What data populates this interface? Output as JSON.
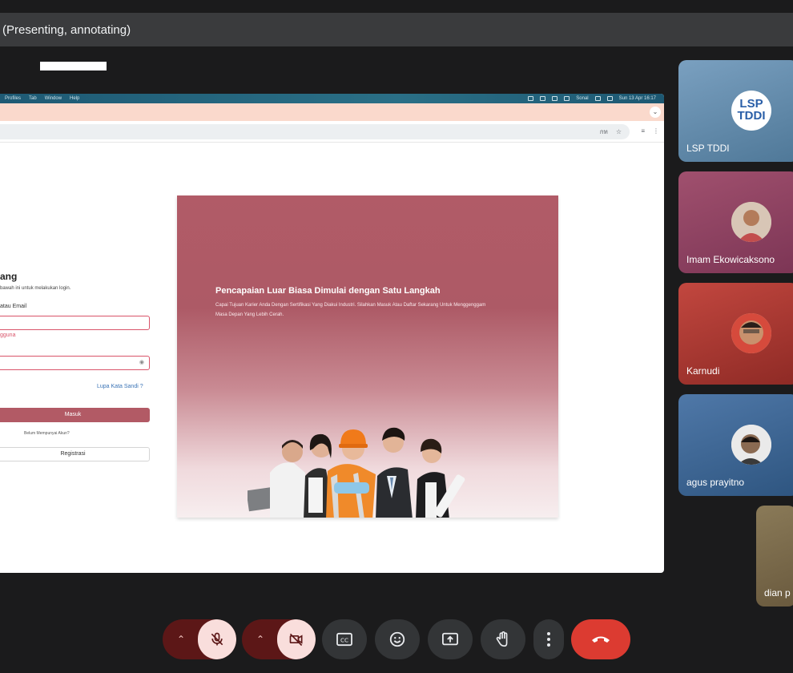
{
  "meeting": {
    "title_suffix": "(Presenting, annotating)"
  },
  "mac_menu": {
    "items": [
      "Profiles",
      "Tab",
      "Window",
      "Help"
    ],
    "status": "Sun 13 Apr  16:17",
    "user_label": "Sonal"
  },
  "browser": {
    "translate_label": "กท",
    "star_icon": "star-icon",
    "menu_icon": "more-vert-icon"
  },
  "login": {
    "title": "ang",
    "subtitle": "bawah ini untuk melakukan login.",
    "email_label": "atau Email",
    "email_error": "gguna",
    "forgot": "Lupa Kata Sandi ?",
    "submit": "Masuk",
    "no_account": "Belum Mempunyai Akun?",
    "register": "Registrasi"
  },
  "hero": {
    "headline": "Pencapaian Luar Biasa Dimulai dengan Satu Langkah",
    "body": "Capai Tujuan Karier Anda Dengan Sertifikasi Yang Diakui Industri. Silahkan Masuk Atau Daftar Sekarang Untuk Menggenggam Masa Depan Yang Lebih Cerah."
  },
  "participants": [
    {
      "name": "LSP TDDI",
      "logo_text_1": "LSP",
      "logo_text_2": "TDDI"
    },
    {
      "name": "Imam Ekowicaksono"
    },
    {
      "name": "Karnudi"
    },
    {
      "name": "agus prayitno"
    },
    {
      "name": "dian p"
    }
  ],
  "controls": {
    "mic": "mic-off-icon",
    "camera": "camera-off-icon",
    "captions": "captions-icon",
    "reactions": "emoji-icon",
    "present": "present-icon",
    "raise_hand": "hand-icon",
    "more": "more-vert-icon",
    "leave": "end-call-icon"
  },
  "colors": {
    "accent_red": "#dc3b31",
    "brand": "#b25a65"
  }
}
